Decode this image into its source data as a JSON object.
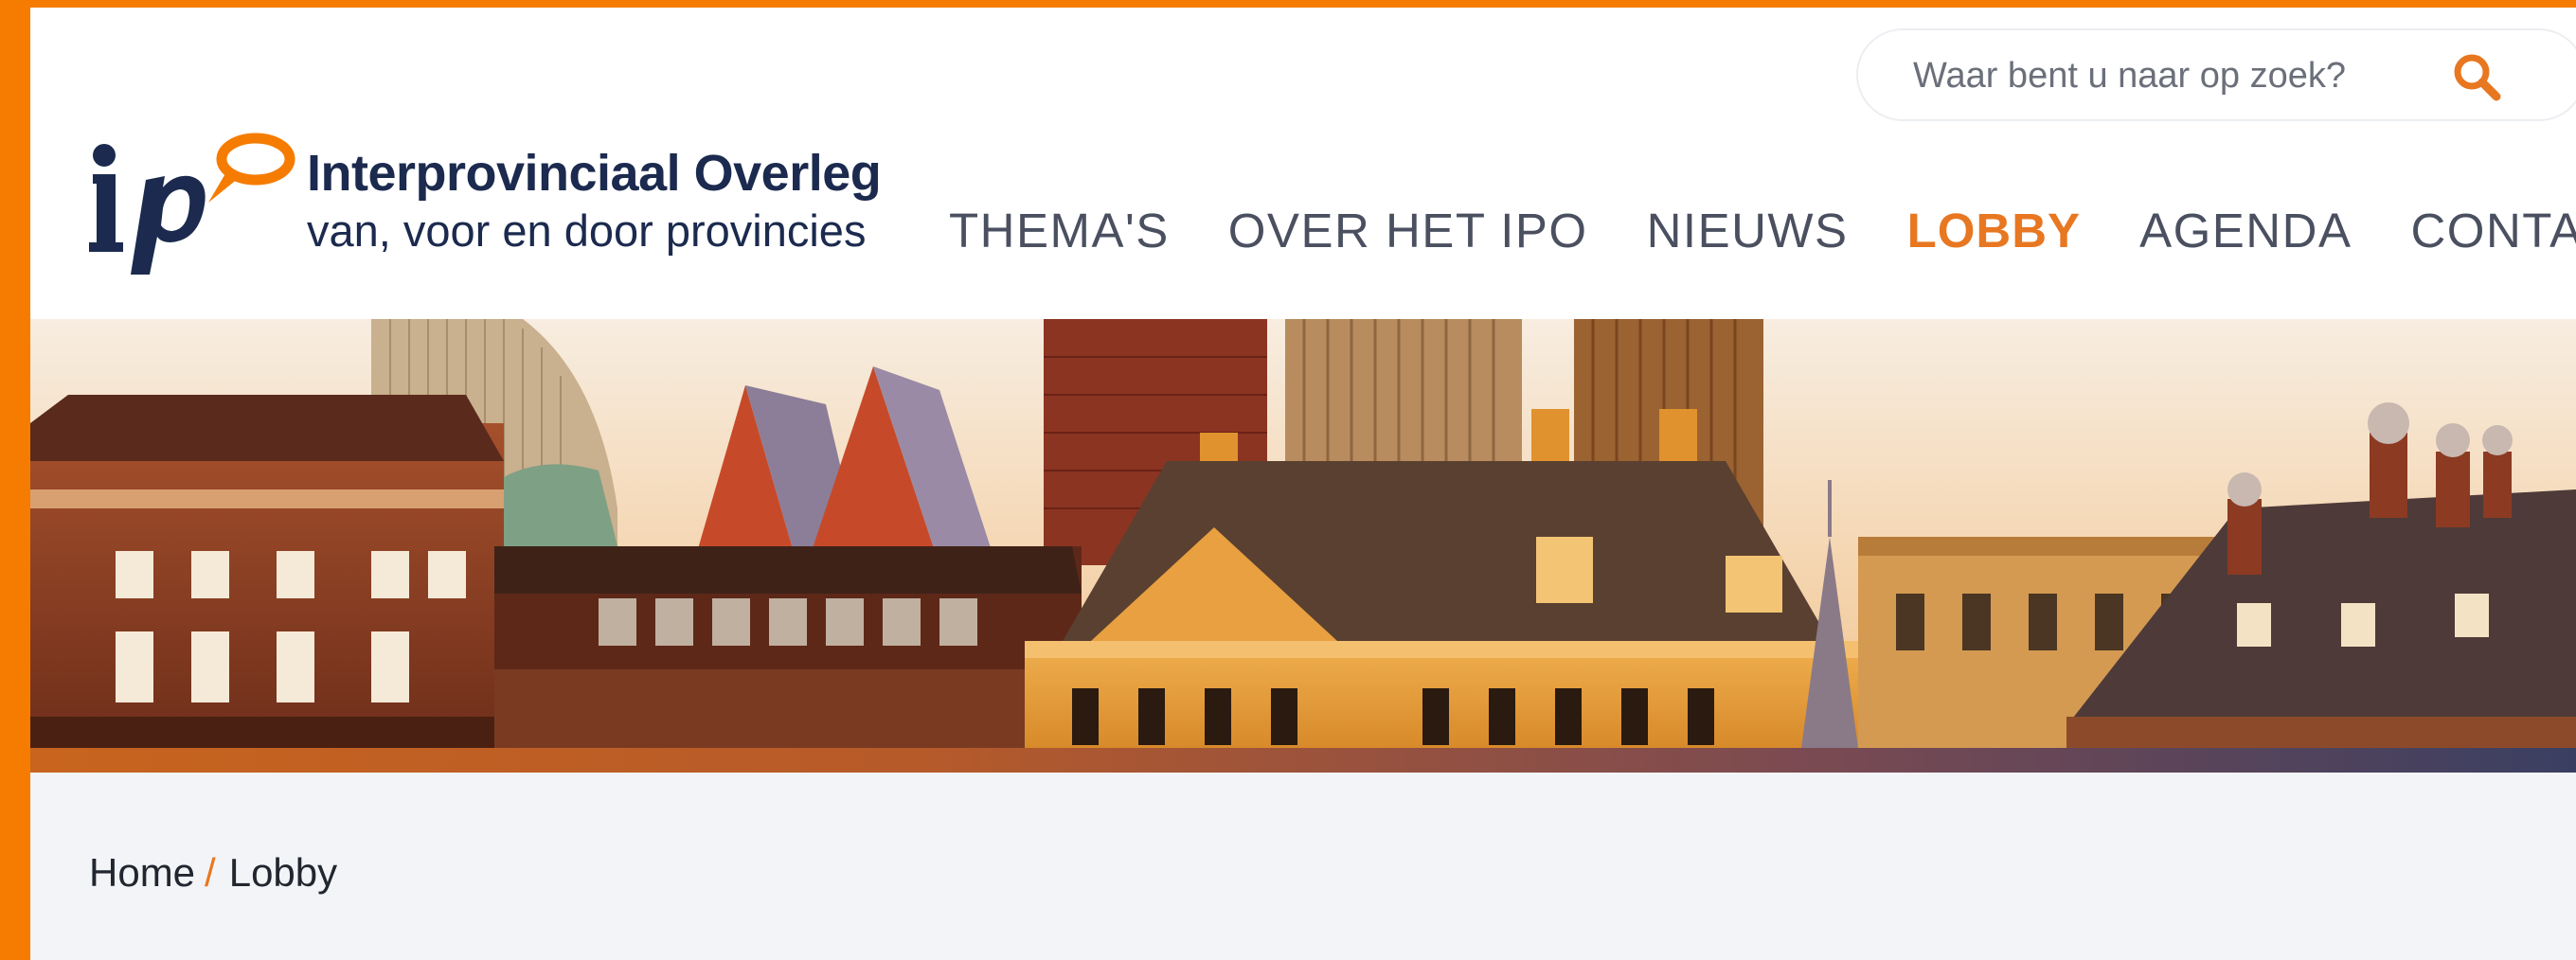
{
  "brand": {
    "name": "Interprovinciaal Overleg",
    "tagline": "van, voor en door provincies",
    "colors": {
      "orange": "#f57c00",
      "navy": "#1b2a4e",
      "accent": "#e87722"
    }
  },
  "search": {
    "placeholder": "Waar bent u naar op zoek?",
    "icon": "search-icon"
  },
  "nav": {
    "items": [
      {
        "label": "THEMA'S",
        "active": false
      },
      {
        "label": "OVER HET IPO",
        "active": false
      },
      {
        "label": "NIEUWS",
        "active": false
      },
      {
        "label": "LOBBY",
        "active": true
      },
      {
        "label": "AGENDA",
        "active": false
      },
      {
        "label": "CONTACT",
        "active": false
      }
    ]
  },
  "breadcrumb": {
    "home": "Home",
    "separator": "/",
    "current": "Lobby"
  }
}
